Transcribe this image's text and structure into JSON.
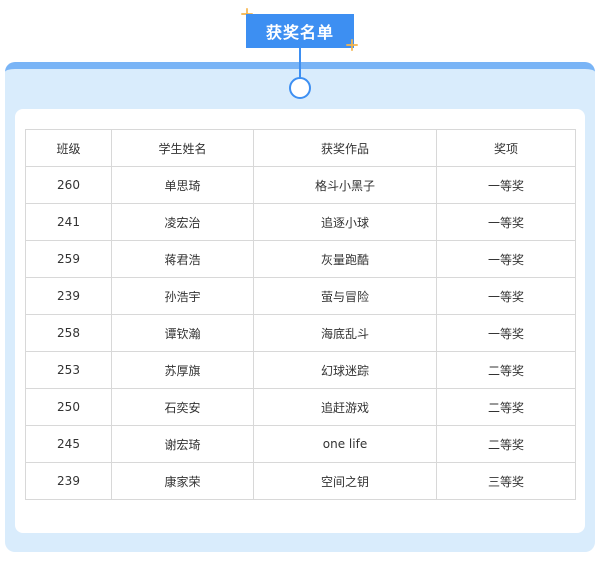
{
  "title": "获奖名单",
  "colors": {
    "accent": "#3d8ff2",
    "panel_bg": "#d9ecfc",
    "panel_top": "#79b4f6",
    "sparkle": "#f6b54b"
  },
  "table": {
    "headers": [
      "班级",
      "学生姓名",
      "获奖作品",
      "奖项"
    ],
    "rows": [
      [
        "260",
        "单思琦",
        "格斗小黑子",
        "一等奖"
      ],
      [
        "241",
        "凌宏治",
        "追逐小球",
        "一等奖"
      ],
      [
        "259",
        "蒋君浩",
        "灰量跑酷",
        "一等奖"
      ],
      [
        "239",
        "孙浩宇",
        "萤与冒险",
        "一等奖"
      ],
      [
        "258",
        "谭钦瀚",
        "海底乱斗",
        "一等奖"
      ],
      [
        "253",
        "苏厚旗",
        "幻球迷踪",
        "二等奖"
      ],
      [
        "250",
        "石奕安",
        "追赶游戏",
        "二等奖"
      ],
      [
        "245",
        "谢宏琦",
        "one life",
        "二等奖"
      ],
      [
        "239",
        "康家荣",
        "空间之钥",
        "三等奖"
      ]
    ]
  }
}
